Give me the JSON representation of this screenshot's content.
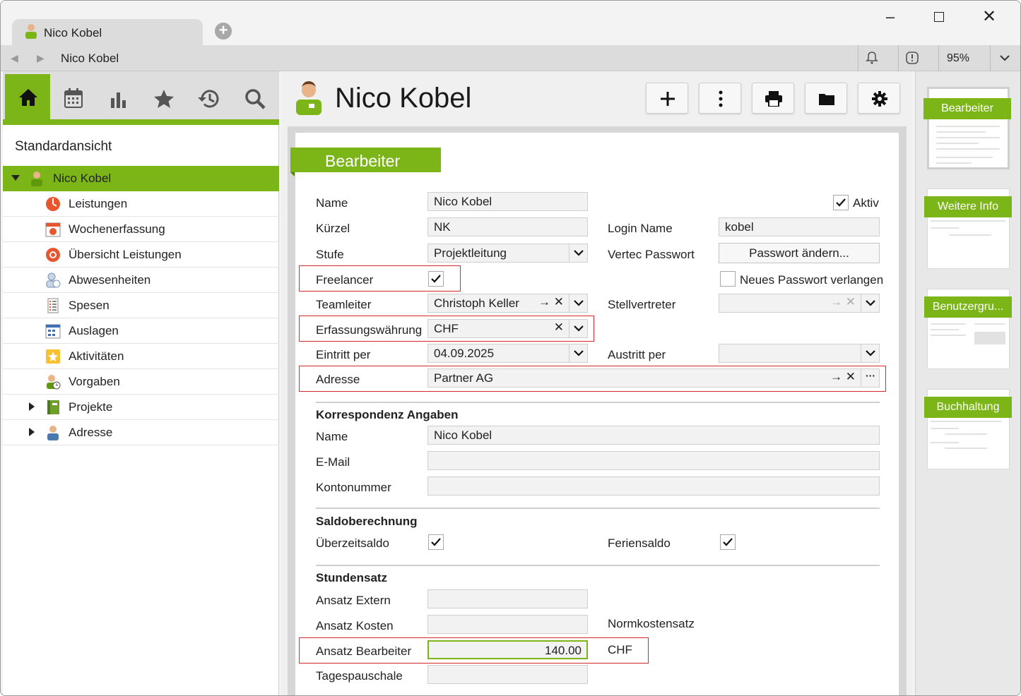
{
  "window": {
    "tab_title": "Nico Kobel",
    "address_title": "Nico Kobel",
    "zoom": "95%"
  },
  "left": {
    "view_title": "Standardansicht",
    "toolbar_icons": [
      "home-icon",
      "calendar-icon",
      "chart-icon",
      "star-icon",
      "history-icon",
      "search-icon"
    ],
    "tree": {
      "root": "Nico Kobel",
      "items": [
        "Leistungen",
        "Wochenerfassung",
        "Übersicht Leistungen",
        "Abwesenheiten",
        "Spesen",
        "Auslagen",
        "Aktivitäten",
        "Vorgaben",
        "Projekte",
        "Adresse"
      ]
    }
  },
  "header": {
    "title": "Nico Kobel"
  },
  "form": {
    "section_title": "Bearbeiter",
    "labels": {
      "name": "Name",
      "aktiv": "Aktiv",
      "kuerzel": "Kürzel",
      "login_name": "Login Name",
      "stufe": "Stufe",
      "vertec_passwort": "Vertec Passwort",
      "freelancer": "Freelancer",
      "neues_passwort": "Neues Passwort verlangen",
      "teamleiter": "Teamleiter",
      "stellvertreter": "Stellvertreter",
      "erfassungswaehrung": "Erfassungswährung",
      "eintritt": "Eintritt per",
      "austritt": "Austritt per",
      "adresse": "Adresse",
      "korr_heading": "Korrespondenz Angaben",
      "korr_name": "Name",
      "email": "E-Mail",
      "kontonummer": "Kontonummer",
      "saldo_heading": "Saldoberechnung",
      "ueberzeitsaldo": "Überzeitsaldo",
      "feriensaldo": "Feriensaldo",
      "stunden_heading": "Stundensatz",
      "ansatz_extern": "Ansatz Extern",
      "ansatz_kosten": "Ansatz Kosten",
      "normkostensatz": "Normkostensatz",
      "ansatz_bearbeiter": "Ansatz Bearbeiter",
      "tagespauschale": "Tagespauschale"
    },
    "values": {
      "name": "Nico Kobel",
      "aktiv": true,
      "kuerzel": "NK",
      "login_name": "kobel",
      "stufe": "Projektleitung",
      "passwort_button": "Passwort ändern...",
      "freelancer": true,
      "neues_passwort": false,
      "teamleiter": "Christoph Keller",
      "stellvertreter": "",
      "erfassungswaehrung": "CHF",
      "eintritt": "04.09.2025",
      "austritt": "",
      "adresse": "Partner AG",
      "korr_name": "Nico Kobel",
      "email": "",
      "kontonummer": "",
      "ueberzeitsaldo": true,
      "feriensaldo": true,
      "ansatz_extern": "",
      "ansatz_kosten": "",
      "ansatz_bearbeiter": "140.00",
      "ansatz_currency": "CHF",
      "tagespauschale": ""
    }
  },
  "right": {
    "pages": [
      "Bearbeiter",
      "Weitere Info",
      "Benutzergru...",
      "Buchhaltung"
    ]
  },
  "colors": {
    "accent": "#7cb518",
    "highlight_border": "#d62828"
  }
}
